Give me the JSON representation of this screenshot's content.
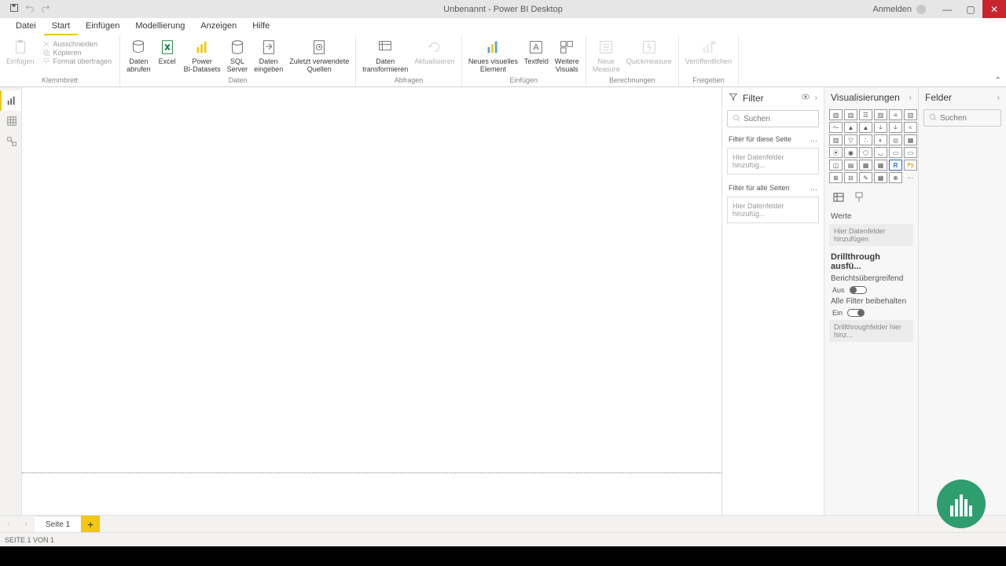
{
  "titlebar": {
    "title": "Unbenannt - Power BI Desktop",
    "signin": "Anmelden"
  },
  "tabs": [
    "Datei",
    "Start",
    "Einfügen",
    "Modellierung",
    "Anzeigen",
    "Hilfe"
  ],
  "activeTab": 1,
  "ribbon": {
    "clipboard": {
      "paste": "Einfügen",
      "cut": "Ausschneiden",
      "copy": "Kopieren",
      "formatPainter": "Format übertragen",
      "groupLabel": "Klemmbrett"
    },
    "data": {
      "getData": "Daten\nabrufen",
      "excel": "Excel",
      "pbiDatasets": "Power\nBI-Datasets",
      "sqlServer": "SQL\nServer",
      "enterData": "Daten\neingeben",
      "recentSources": "Zuletzt verwendete\nQuellen",
      "groupLabel": "Daten"
    },
    "queries": {
      "transform": "Daten\ntransformieren",
      "refresh": "Aktualisieren",
      "groupLabel": "Abfragen"
    },
    "insert": {
      "newVisual": "Neues visuelles\nElement",
      "textBox": "Textfeld",
      "moreVisuals": "Weitere\nVisuals",
      "groupLabel": "Einfügen"
    },
    "calc": {
      "newMeasure": "Neue\nMeasure",
      "quickMeasure": "Quickmeasure",
      "groupLabel": "Berechnungen"
    },
    "share": {
      "publish": "Veröffentlichen",
      "groupLabel": "Freigeben"
    }
  },
  "filter": {
    "title": "Filter",
    "searchPlaceholder": "Suchen",
    "thisPage": "Filter für diese Seite",
    "allPages": "Filter für alle Seiten",
    "addFields": "Hier Datenfelder hinzufüg..."
  },
  "viz": {
    "title": "Visualisierungen",
    "values": "Werte",
    "addFields": "Hier Datenfelder hinzufügen",
    "drillTitle": "Drillthrough ausfü...",
    "crossReport": "Berichtsübergreifend",
    "crossReportState": "Aus",
    "keepFilters": "Alle Filter beibehalten",
    "keepFiltersState": "Ein",
    "drillAdd": "Drillthroughfelder hier hinz..."
  },
  "fields": {
    "title": "Felder",
    "searchPlaceholder": "Suchen"
  },
  "pagetabs": {
    "page1": "Seite 1"
  },
  "statusbar": "SEITE 1 VON 1"
}
